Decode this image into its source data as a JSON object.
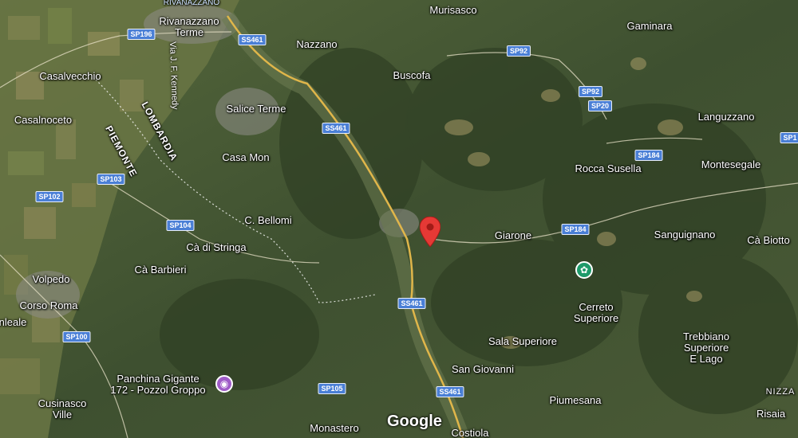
{
  "map": {
    "labels": {
      "rivanazzano_top": "RIVANAZZANO",
      "rivanazzano_terme": "Rivanazzano\nTerme",
      "murisasco": "Murisasco",
      "gaminara": "Gaminara",
      "nazzano": "Nazzano",
      "buscofa": "Buscofa",
      "casalvecchio": "Casalvecchio",
      "casalnoceto": "Casalnoceto",
      "salice_terme": "Salice Terme",
      "languzzano": "Languzzano",
      "casa_mon": "Casa Mon",
      "rocca_susella": "Rocca Susella",
      "montesegale": "Montesegale",
      "c_bellomi": "C. Bellomi",
      "giarone": "Giarone",
      "sanguignano": "Sanguignano",
      "ca_biotto": "Cà Biotto",
      "ca_di_stringa": "Cà di Stringa",
      "ca_barbieri": "Cà Barbieri",
      "volpedo": "Volpedo",
      "corso_roma": "Corso Roma",
      "cerreto_superiore": "Cerreto\nSuperiore",
      "nleale": "nleale",
      "sala_superiore": "Sala Superiore",
      "trebbiano": "Trebbiano\nSuperiore\nE Lago",
      "panchina": "Panchina Gigante\n172 - Pozzol Groppo",
      "san_giovanni": "San Giovanni",
      "cusinasco_ville": "Cusinasco\nVille",
      "piumesana": "Piumesana",
      "nizza": "NIZZA",
      "monastero": "Monastero",
      "costiola": "Costiola",
      "risaia": "Risaia"
    },
    "regions": {
      "lombardia": "LOMBARDIA",
      "piemonte": "PIEMONTE"
    },
    "streets": {
      "via_kennedy": "Via J. F. Kennedy"
    },
    "road_shields": [
      "SP196",
      "SS461",
      "SP92",
      "SP92",
      "SP20",
      "SS461",
      "SP184",
      "SP103",
      "SP102",
      "SP104",
      "SP184",
      "SS461",
      "SP100",
      "SP105",
      "SS461",
      "SP1"
    ],
    "attribution": "Google",
    "marker": {
      "color": "#e53935"
    },
    "colors": {
      "park_poi": "#1e9a6a",
      "landmark_poi": "#a05cc8",
      "road_shield": "#4a7fd6"
    }
  }
}
